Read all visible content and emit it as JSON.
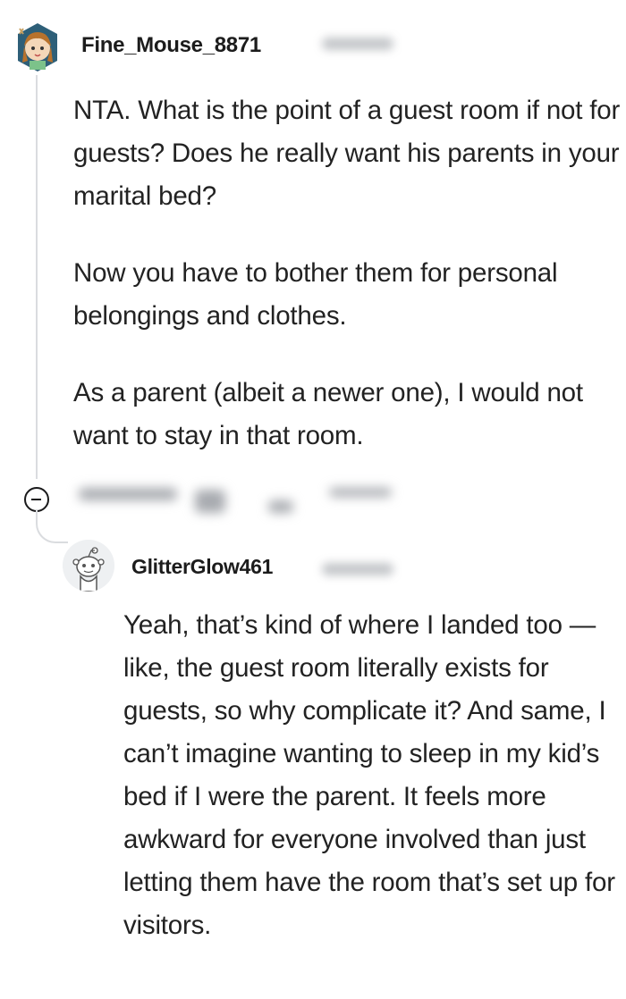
{
  "comment": {
    "username": "Fine_Mouse_8871",
    "paragraphs": [
      "NTA. What is the point of a guest room if not for guests? Does he really want his parents in your marital bed?",
      "Now you have to bother them for personal belongings and clothes.",
      "As a parent (albeit a newer one), I would not want to stay in that room."
    ],
    "avatar_icon": "cartoon-avatar-icon",
    "collapse_icon": "collapse-minus-icon"
  },
  "reply": {
    "username": "GlitterGlow461",
    "text": "Yeah, that’s kind of where I landed too — like, the guest room literally exists for guests, so why complicate it? And same, I can’t imagine wanting to sleep in my kid’s bed if I were the parent. It feels more awkward for everyone involved than just letting them have the room that’s set up for visitors.",
    "avatar_icon": "snoo-avatar-icon"
  },
  "colors": {
    "thread_line": "#dadcdf",
    "text": "#222222",
    "username": "#1c1c1c",
    "avatar_bg": "#2e5f78"
  }
}
